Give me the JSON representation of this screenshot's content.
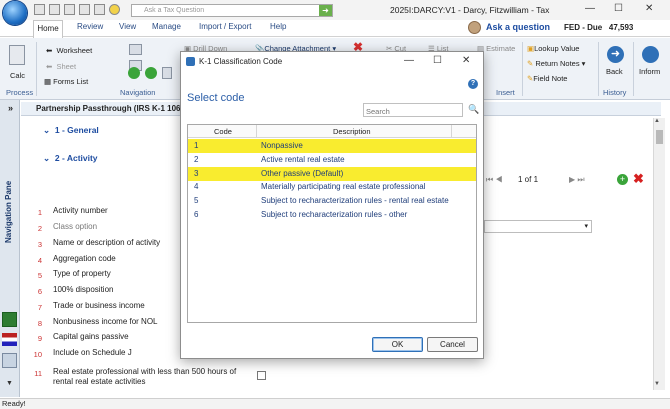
{
  "window": {
    "title": "2025I:DARCY:V1 - Darcy, Fitzwilliam - Tax",
    "ask_placeholder": "Ask a Tax Question"
  },
  "menu": [
    "Home",
    "Review",
    "View",
    "Manage",
    "Import / Export",
    "Help"
  ],
  "ask_question": "Ask a question",
  "fed": {
    "label": "FED - Due",
    "value": "47,593"
  },
  "ribbon": {
    "calc": "Calc",
    "process": "Process",
    "worksheet": "Worksheet",
    "sheet": "Sheet",
    "forms_list": "Forms List",
    "navigation": "Navigation",
    "drill_down": "Drill Down",
    "change_attachment": "Change Attachment",
    "cut": "Cut",
    "list": "List",
    "estimate": "Estimate",
    "lookup_value": "Lookup Value",
    "return_notes": "Return Notes",
    "field_note": "Field Note",
    "insert": "Insert",
    "back": "Back",
    "history": "History",
    "inform": "Inform"
  },
  "form": {
    "header": "Partnership Passthrough (IRS K-1 106",
    "section1": "1 - General",
    "section2": "2 - Activity",
    "pager": "1 of 1",
    "rows": [
      {
        "num": "1",
        "label": "Activity number"
      },
      {
        "num": "2",
        "label": "Class option"
      },
      {
        "num": "3",
        "label": "Name or description of activity"
      },
      {
        "num": "4",
        "label": "Aggregation code"
      },
      {
        "num": "5",
        "label": "Type of property"
      },
      {
        "num": "6",
        "label": "100% disposition"
      },
      {
        "num": "7",
        "label": "Trade or business income"
      },
      {
        "num": "8",
        "label": "Nonbusiness income for NOL"
      },
      {
        "num": "9",
        "label": "Capital gains passive"
      },
      {
        "num": "10",
        "label": "Include on Schedule J"
      },
      {
        "num": "11",
        "label": "Real estate professional with less than 500 hours of rental real estate activities"
      }
    ]
  },
  "nav_pane": "Navigation Pane",
  "status": "Ready!",
  "dialog": {
    "title": "K-1 Classification Code",
    "heading": "Select code",
    "search_placeholder": "Search",
    "columns": {
      "code": "Code",
      "description": "Description"
    },
    "items": [
      {
        "code": "1",
        "description": "Nonpassive",
        "highlighted": true
      },
      {
        "code": "2",
        "description": "Active rental real estate",
        "highlighted": false
      },
      {
        "code": "3",
        "description": "Other passive (Default)",
        "highlighted": true
      },
      {
        "code": "4",
        "description": "Materially participating real estate professional",
        "highlighted": false
      },
      {
        "code": "5",
        "description": "Subject to recharacterization rules - rental real estate",
        "highlighted": false
      },
      {
        "code": "6",
        "description": "Subject to recharacterization rules - other",
        "highlighted": false
      }
    ],
    "ok": "OK",
    "cancel": "Cancel"
  },
  "colors": {
    "highlight": "#f9ec2f",
    "accent": "#2b5ea7"
  }
}
